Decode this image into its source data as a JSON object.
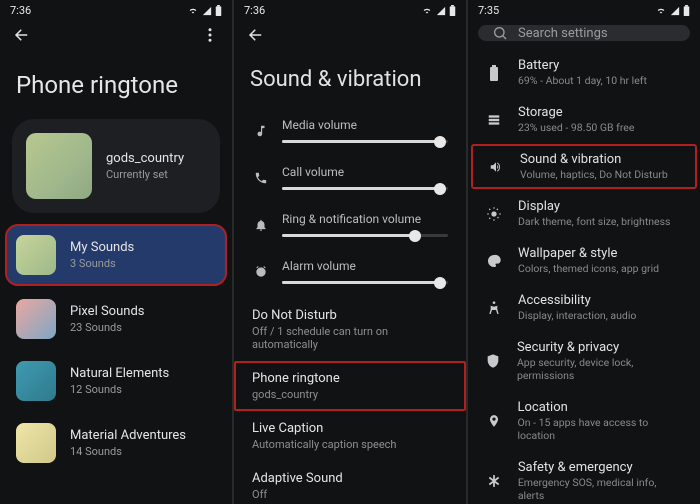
{
  "status": {
    "time_a": "7:36",
    "time_b": "7:36",
    "time_c": "7:35"
  },
  "pane1": {
    "title": "Phone ringtone",
    "current": {
      "name": "gods_country",
      "sub": "Currently set"
    },
    "categories": [
      {
        "name": "My Sounds",
        "sub": "3 Sounds"
      },
      {
        "name": "Pixel Sounds",
        "sub": "23 Sounds"
      },
      {
        "name": "Natural Elements",
        "sub": "12 Sounds"
      },
      {
        "name": "Material Adventures",
        "sub": "14 Sounds"
      }
    ]
  },
  "pane2": {
    "title": "Sound & vibration",
    "sliders": [
      {
        "label": "Media volume",
        "value": 95
      },
      {
        "label": "Call volume",
        "value": 95
      },
      {
        "label": "Ring & notification volume",
        "value": 80
      },
      {
        "label": "Alarm volume",
        "value": 95
      }
    ],
    "rows": [
      {
        "t1": "Do Not Disturb",
        "t2": "Off / 1 schedule can turn on automatically"
      },
      {
        "t1": "Phone ringtone",
        "t2": "gods_country"
      },
      {
        "t1": "Live Caption",
        "t2": "Automatically caption speech"
      },
      {
        "t1": "Adaptive Sound",
        "t2": "Off"
      }
    ]
  },
  "pane3": {
    "search_placeholder": "Search settings",
    "items": [
      {
        "t1": "Battery",
        "t2": "69% - About 1 day, 10 hr left",
        "icon": "battery"
      },
      {
        "t1": "Storage",
        "t2": "23% used - 98.50 GB free",
        "icon": "storage"
      },
      {
        "t1": "Sound & vibration",
        "t2": "Volume, haptics, Do Not Disturb",
        "icon": "sound"
      },
      {
        "t1": "Display",
        "t2": "Dark theme, font size, brightness",
        "icon": "display"
      },
      {
        "t1": "Wallpaper & style",
        "t2": "Colors, themed icons, app grid",
        "icon": "palette"
      },
      {
        "t1": "Accessibility",
        "t2": "Display, interaction, audio",
        "icon": "accessibility"
      },
      {
        "t1": "Security & privacy",
        "t2": "App security, device lock, permissions",
        "icon": "security"
      },
      {
        "t1": "Location",
        "t2": "On - 15 apps have access to location",
        "icon": "location"
      },
      {
        "t1": "Safety & emergency",
        "t2": "Emergency SOS, medical info, alerts",
        "icon": "safety"
      }
    ]
  },
  "gradients": {
    "current": "linear-gradient(135deg,#b9c78f,#9fb88c 60%,#8fa883)",
    "cat0": "linear-gradient(135deg,#c6d49a,#9eb98a)",
    "cat1": "linear-gradient(135deg,#e9a7a1,#7fa7c4)",
    "cat2": "linear-gradient(135deg,#3f9ab0,#2f7a8d)",
    "cat3": "linear-gradient(135deg,#efe6a7,#cfc888)"
  }
}
